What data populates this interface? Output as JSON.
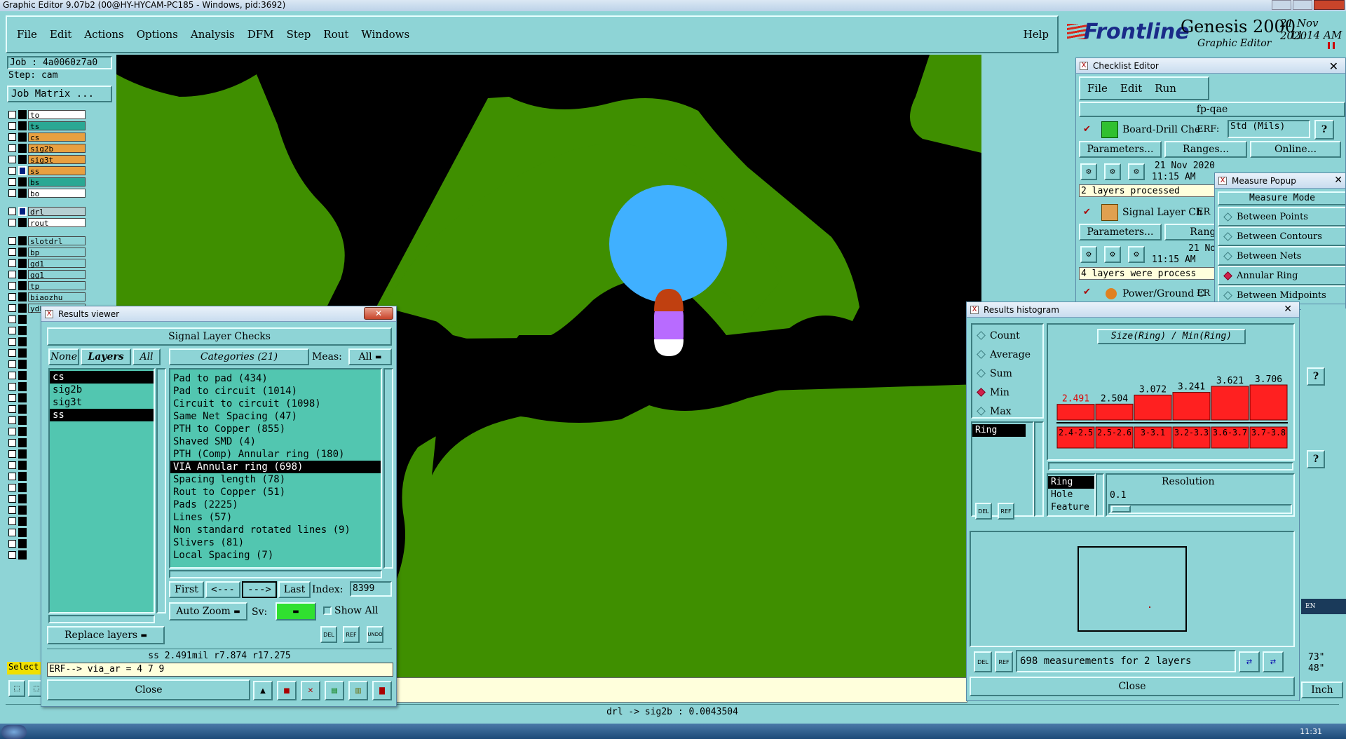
{
  "window_title": "Graphic Editor 9.07b2 (00@HY-HYCAM-PC185 - Windows, pid:3692)",
  "menu": [
    "File",
    "Edit",
    "Actions",
    "Options",
    "Analysis",
    "DFM",
    "Step",
    "Rout",
    "Windows"
  ],
  "help": "Help",
  "brand": {
    "logo": "Frontline",
    "product": "Genesis 2000",
    "subtitle": "Graphic Editor",
    "date": "21 Nov 2020",
    "time": "11:14 AM"
  },
  "job": {
    "job": "Job : 4a0060z7a0",
    "step": "Step: cam",
    "matrix_btn": "Job Matrix ..."
  },
  "layers_top": [
    {
      "name": "to",
      "color": "#ffffff"
    },
    {
      "name": "ts",
      "color": "#2aa894"
    },
    {
      "name": "cs",
      "color": "#e8a040"
    },
    {
      "name": "sig2b",
      "color": "#e8a040"
    },
    {
      "name": "sig3t",
      "color": "#e8a040"
    },
    {
      "name": "ss",
      "color": "#e8a040"
    },
    {
      "name": "bs",
      "color": "#2aa894"
    },
    {
      "name": "bo",
      "color": "#ffffff"
    }
  ],
  "layers_drill": [
    {
      "name": "drl",
      "color": "#b6cfd2"
    },
    {
      "name": "rout",
      "color": "#ffffff"
    }
  ],
  "layers_misc": [
    "slotdrl",
    "bp",
    "gd1",
    "gg1",
    "tp",
    "biaozhu",
    "ydkdrl"
  ],
  "status_bar": "drl -> sig2b : 0.0043504",
  "select_label": "Select",
  "inch_label": "Inch",
  "results_viewer": {
    "title": "Results viewer",
    "header": "Signal Layer Checks",
    "none": "None",
    "layers": "Layers",
    "all": "All",
    "categories_btn": "Categories (21)",
    "meas_label": "Meas:",
    "meas_value": "All",
    "layer_list": [
      "cs",
      "sig2b",
      "sig3t",
      "ss"
    ],
    "categories": [
      "Pad to pad (434)",
      "Pad to circuit (1014)",
      "Circuit to circuit (1098)",
      "Same Net Spacing (47)",
      "PTH to Copper (855)",
      "Shaved SMD (4)",
      "PTH (Comp) Annular ring (180)",
      "VIA Annular ring (698)",
      "Spacing length (78)",
      "Rout to Copper (51)",
      "Pads (2225)",
      "Lines (57)",
      "Non standard rotated lines (9)",
      "Slivers (81)",
      "Local Spacing (7)"
    ],
    "selected_category": "VIA Annular ring (698)",
    "first": "First",
    "prev": "<---",
    "next": "--->",
    "last": "Last",
    "index_label": "Index:",
    "index_value": "8399",
    "auto_zoom": "Auto Zoom",
    "sv": "Sv:",
    "show_all": "Show All",
    "replace_layers": "Replace layers",
    "del": "DEL",
    "ref": "REF",
    "undo": "UNDO",
    "readout": "ss 2.491mil  r7.874  r17.275",
    "erf": "ERF--> via_ar = 4 7 9",
    "close": "Close"
  },
  "checklist": {
    "title": "Checklist Editor",
    "menu": [
      "File",
      "Edit",
      "Run"
    ],
    "name": "fp-qae",
    "check1": {
      "name": "Board-Drill Che",
      "erf": "ERF:",
      "erf_value": "Std (Mils)",
      "params": "Parameters...",
      "ranges": "Ranges...",
      "online": "Online...",
      "date": "21 Nov 2020",
      "time": "11:15 AM",
      "status": "2 layers processed"
    },
    "check2": {
      "name": "Signal Layer Ch",
      "erf": "ER",
      "params": "Parameters...",
      "ranges": "Range",
      "date": "21 Nov",
      "time": "11:15 AM",
      "status": "4 layers were process"
    },
    "check3": {
      "name": "Power/Ground C",
      "erf": "ER"
    }
  },
  "measure": {
    "title": "Measure Popup",
    "header": "Measure Mode",
    "modes": [
      "Between Points",
      "Between Contours",
      "Between Nets",
      "Annular Ring",
      "Between Midpoints"
    ],
    "selected": "Annular Ring"
  },
  "histogram": {
    "title": "Results histogram",
    "modes": [
      "Count",
      "Average",
      "Sum",
      "Min",
      "Max"
    ],
    "selected_mode": "Min",
    "chart_title": "Size(Ring) / Min(Ring)",
    "list": [
      "Ring"
    ],
    "props": [
      "Ring",
      "Hole",
      "Feature"
    ],
    "resolution_label": "Resolution",
    "resolution_value": "0.1",
    "summary": "698 measurements for 2 layers",
    "close": "Close",
    "chart_data": {
      "type": "bar",
      "categories": [
        "2.4-2.5",
        "2.5-2.6",
        "3-3.1",
        "3.2-3.3",
        "3.6-3.7",
        "3.7-3.8"
      ],
      "values": [
        2.491,
        2.504,
        3.072,
        3.241,
        3.621,
        3.706
      ],
      "highlight": "#ff2020"
    }
  },
  "taskbar_time": "11:31",
  "right_edge": {
    "v1": "73\"",
    "v2": "48\"",
    "lang": "EN"
  }
}
